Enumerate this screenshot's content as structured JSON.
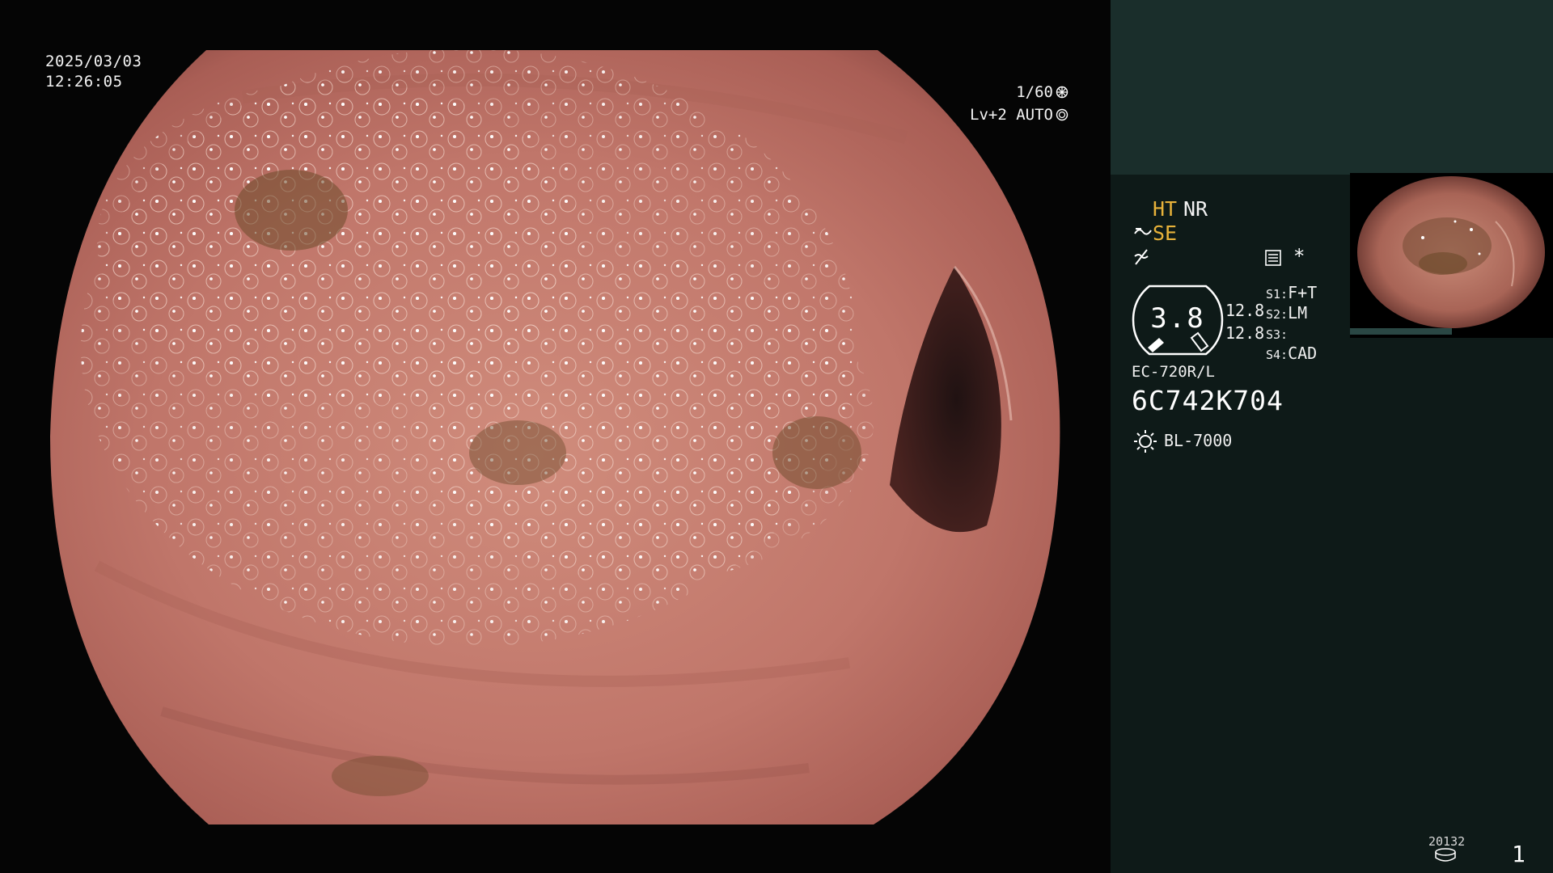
{
  "overlay": {
    "date": "2025/03/03",
    "time": "12:26:05",
    "shutter": "1/60",
    "level": "Lv+2",
    "mode": "AUTO"
  },
  "panel": {
    "mode_ht": "HT",
    "mode_nr": "NR",
    "mode_se": "SE",
    "asterisk": "*",
    "gauge_value": "3.8",
    "gauge_sub_1": "12.8",
    "gauge_sub_2": "12.8",
    "switches": [
      {
        "key": "S1:",
        "value": "F+T"
      },
      {
        "key": "S2:",
        "value": "LM"
      },
      {
        "key": "S3:",
        "value": ""
      },
      {
        "key": "S4:",
        "value": "CAD"
      }
    ],
    "scope_model": "EC-720R/L",
    "serial": "6C742K704",
    "light_source": "BL-7000",
    "counter": "20132",
    "page_number": "1"
  },
  "colors": {
    "accent": "#e8b23a",
    "panel_bg": "#0e1a18",
    "panel_top": "#1a2e2b",
    "tissue": "#c7786a"
  },
  "icons": [
    "shutter-icon",
    "auto-ring-icon",
    "tilde-arrow-icon",
    "wave-icon",
    "document-icon",
    "sun-icon",
    "disk-icon"
  ]
}
